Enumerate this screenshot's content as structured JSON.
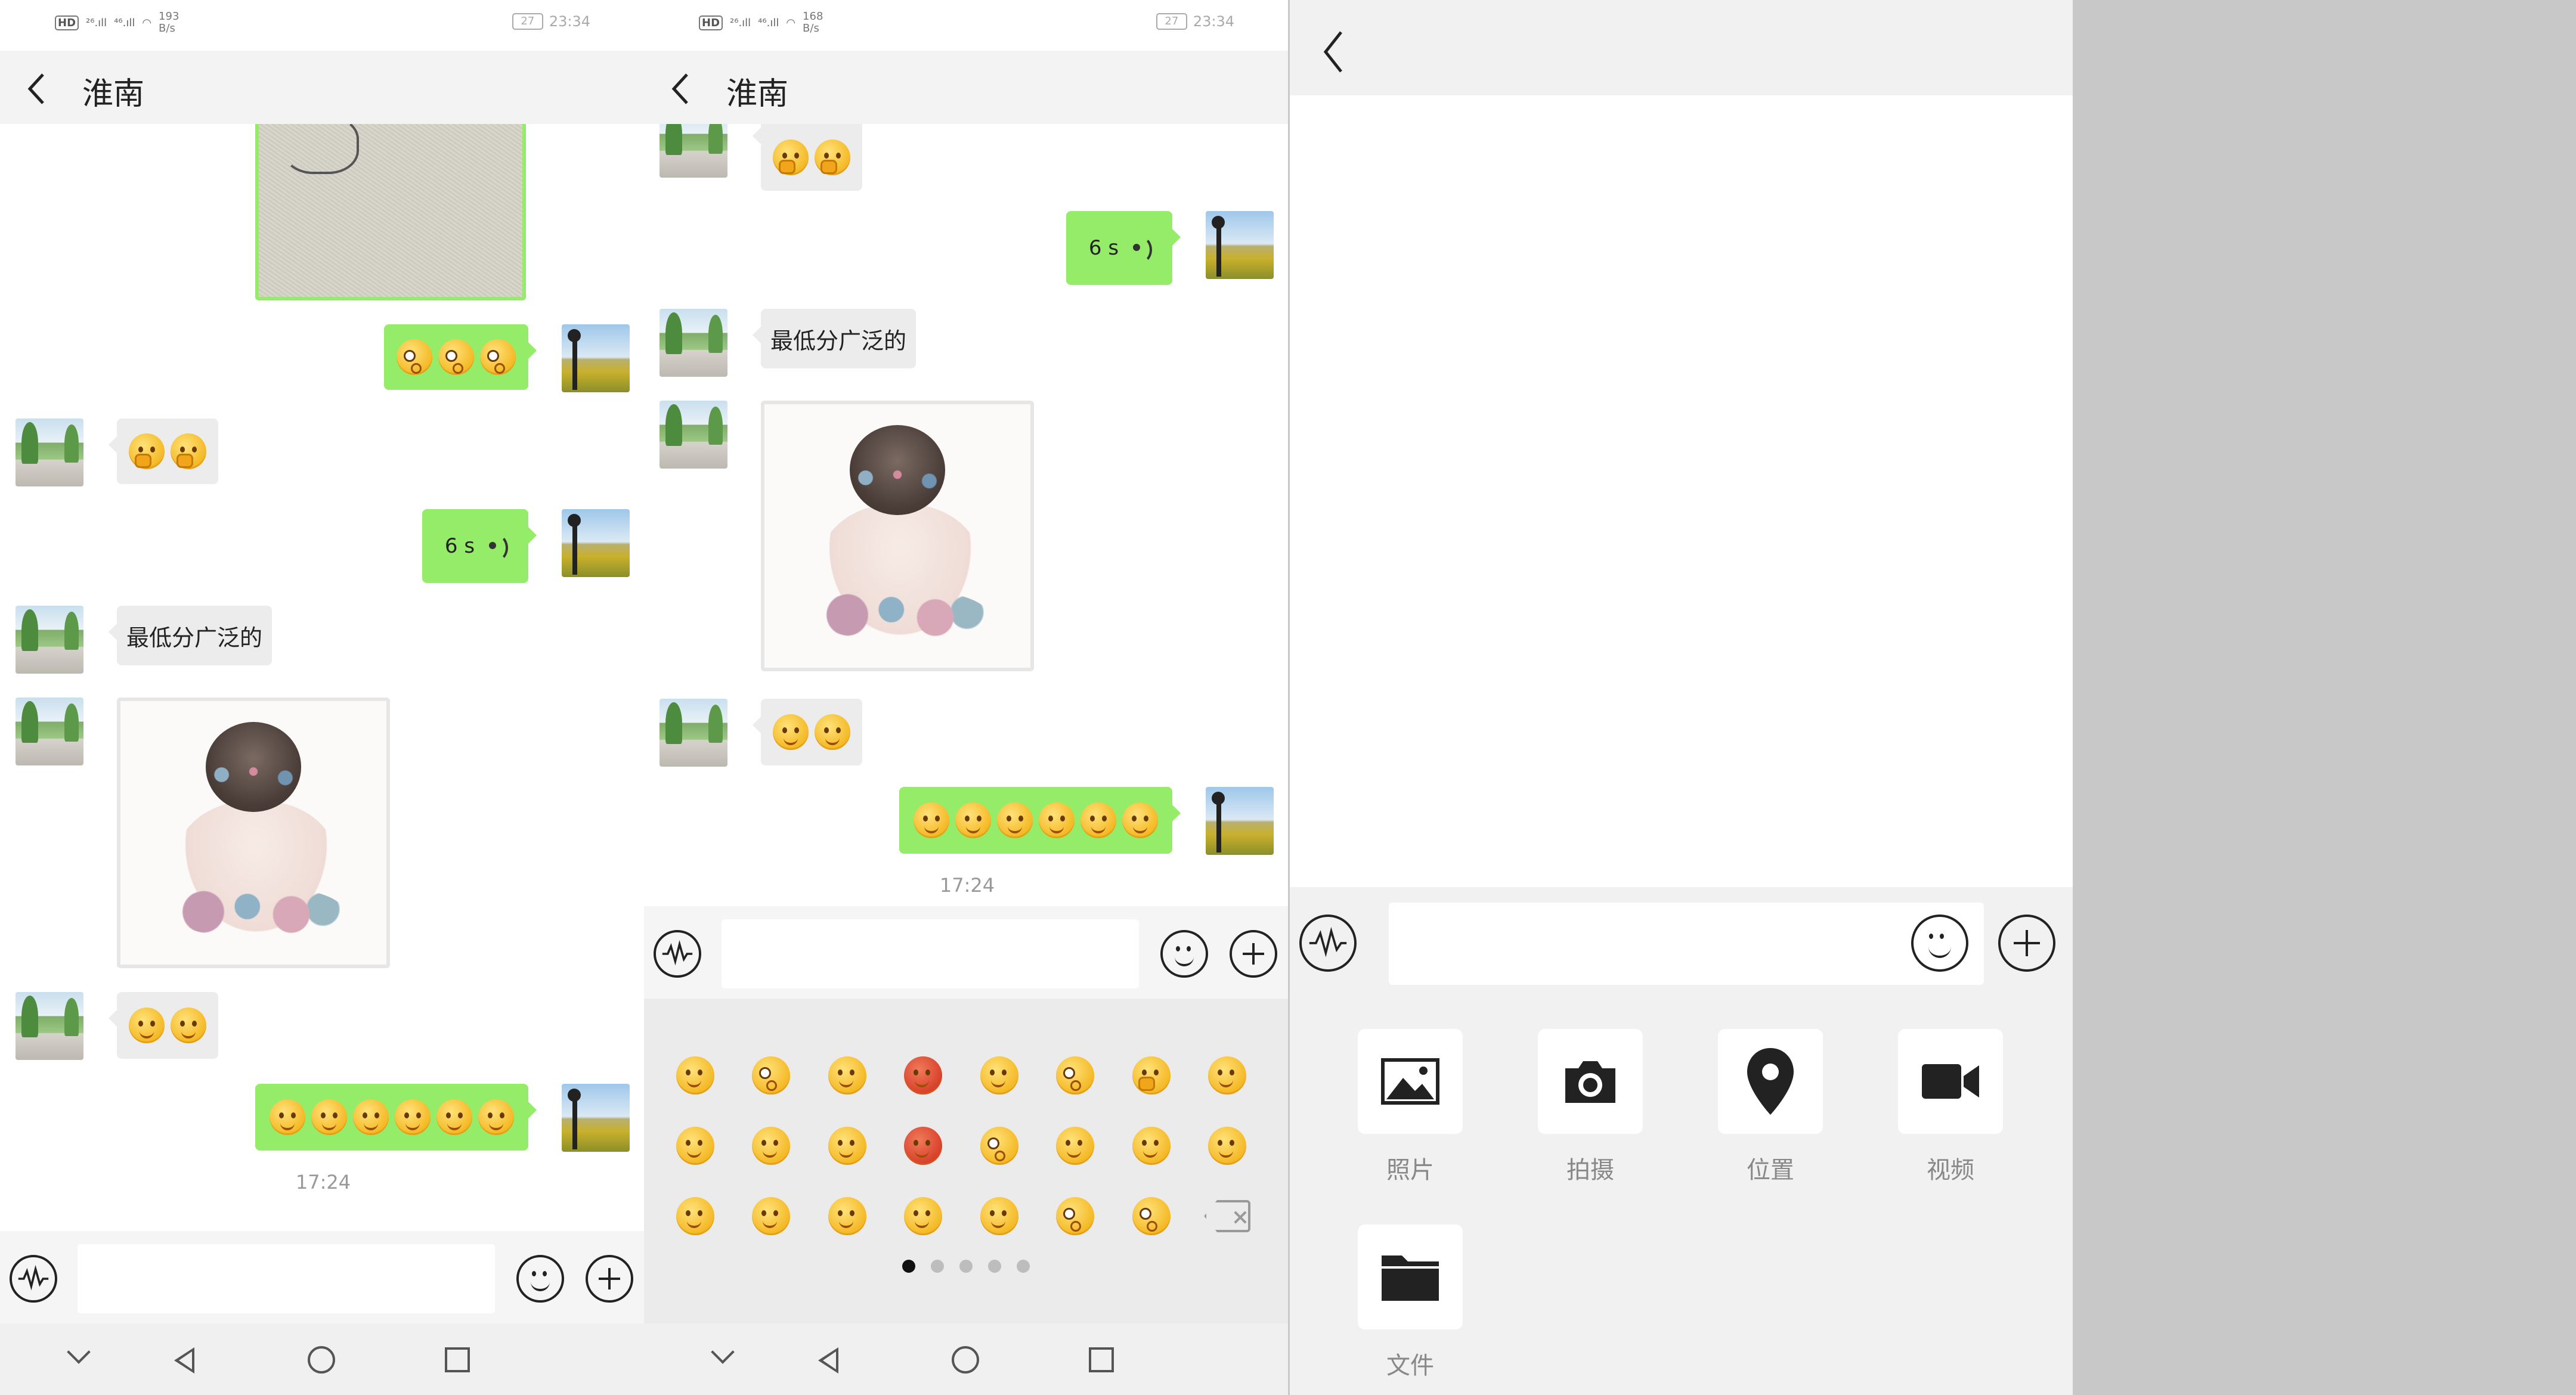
{
  "status_bar": {
    "hd": "HD",
    "sig1": "²⁶.ıll",
    "sig2": "⁴⁶.ıll",
    "speed1": "193",
    "speed2": "168",
    "unit": "B/s",
    "battery": "27",
    "time": "23:34"
  },
  "chat": {
    "title": "淮南",
    "voice_duration": "6 s",
    "text_message": "最低分广泛的",
    "timestamp": "17:24"
  },
  "emoji_panel": {
    "pages": 5,
    "active_page": 1
  },
  "tools": [
    {
      "label": "照片",
      "icon": "photo-icon"
    },
    {
      "label": "拍摄",
      "icon": "camera-icon"
    },
    {
      "label": "位置",
      "icon": "location-icon"
    },
    {
      "label": "视频",
      "icon": "video-icon"
    },
    {
      "label": "文件",
      "icon": "folder-icon"
    }
  ],
  "colors": {
    "bubble_sent": "#95ec69",
    "bubble_received": "#ececec",
    "nav_bg": "#f3f3f3"
  }
}
